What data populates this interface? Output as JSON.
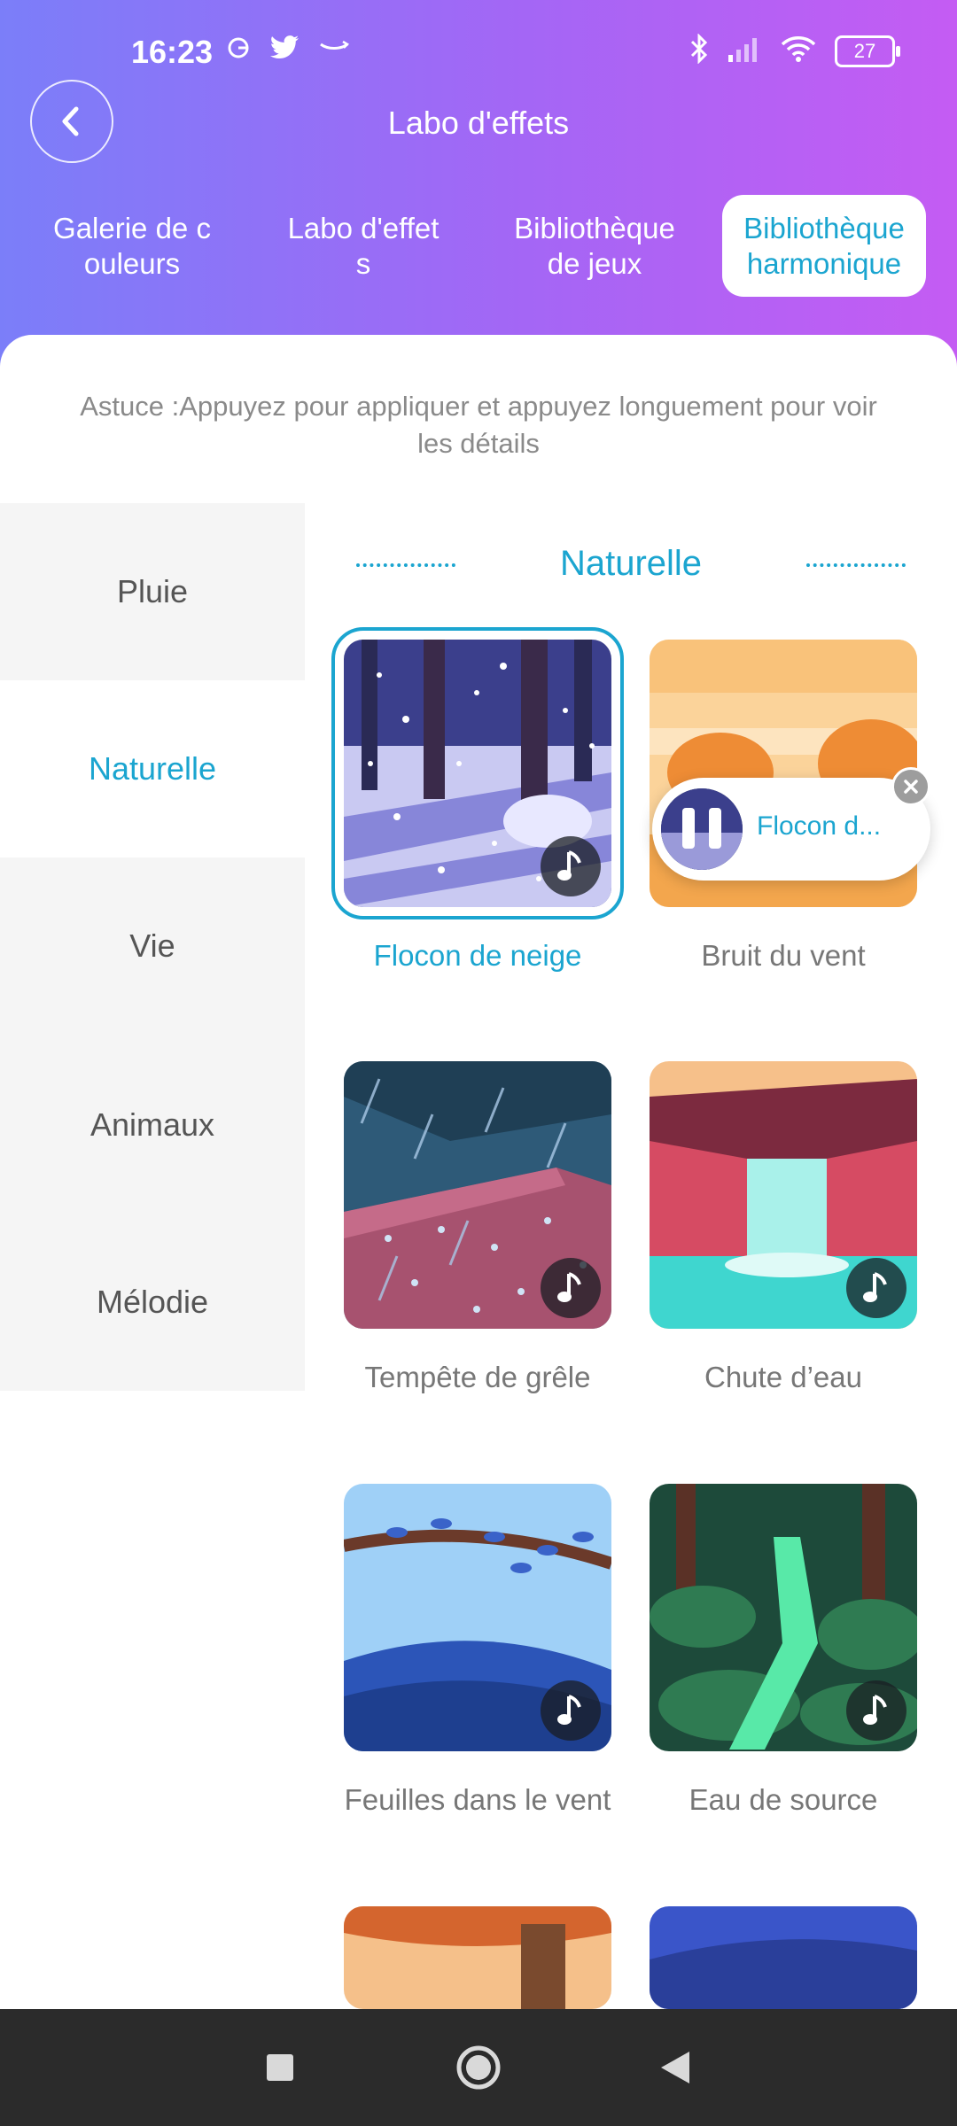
{
  "status": {
    "time": "16:23",
    "battery": "27"
  },
  "header": {
    "title": "Labo d'effets"
  },
  "tabs": [
    {
      "label": "Galerie de c\nouleurs"
    },
    {
      "label": "Labo d'effet\ns"
    },
    {
      "label": "Bibliothèque\nde jeux"
    },
    {
      "label": "Bibliothèque\nharmonique"
    }
  ],
  "hint": "Astuce :Appuyez pour appliquer et appuyez longuement pour voir les détails",
  "sidebar": {
    "items": [
      {
        "label": "Pluie"
      },
      {
        "label": "Naturelle"
      },
      {
        "label": "Vie"
      },
      {
        "label": "Animaux"
      },
      {
        "label": "Mélodie"
      }
    ]
  },
  "section": {
    "title": "Naturelle"
  },
  "sounds": [
    {
      "label": "Flocon de neige",
      "selected": true
    },
    {
      "label": "Bruit du vent"
    },
    {
      "label": "Tempête de grêle"
    },
    {
      "label": "Chute d’eau"
    },
    {
      "label": "Feuilles dans le vent"
    },
    {
      "label": "Eau de source"
    }
  ],
  "player": {
    "title": "Flocon d..."
  },
  "colors": {
    "accent": "#1ba5d0",
    "gradient_start": "#7b7ef9",
    "gradient_end": "#c45cf3"
  }
}
